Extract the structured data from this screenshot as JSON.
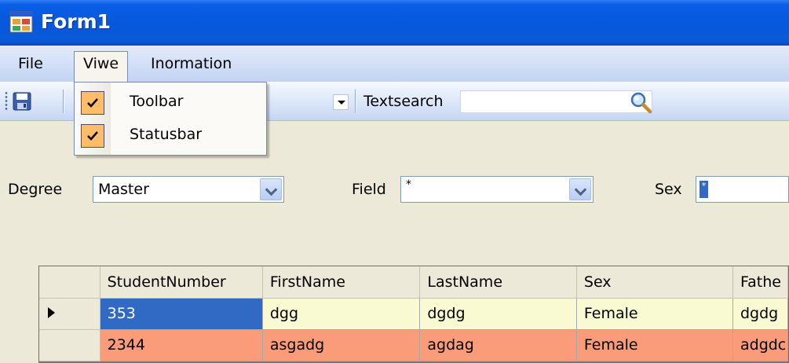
{
  "window": {
    "title": "Form1"
  },
  "menu": {
    "file": "File",
    "view": "Viwe",
    "information": "Inormation"
  },
  "view_menu": {
    "items": [
      {
        "label": "Toolbar",
        "checked": true
      },
      {
        "label": "Statusbar",
        "checked": true
      }
    ]
  },
  "toolbar": {
    "search_label": "Textsearch",
    "search_value": ""
  },
  "filters": {
    "degree_label": "Degree",
    "degree_value": "Master",
    "field_label": "Field",
    "field_value": "*",
    "sex_label": "Sex",
    "sex_value": "*"
  },
  "grid": {
    "columns": [
      "StudentNumber",
      "FirstName",
      "LastName",
      "Sex",
      "Fathe"
    ],
    "rows": [
      {
        "values": [
          "353",
          "dgg",
          "dgdg",
          "Female",
          "dgdg"
        ],
        "current": true
      },
      {
        "values": [
          "2344",
          "asgadg",
          "agdag",
          "Female",
          "adgdc"
        ],
        "current": false
      }
    ]
  },
  "colors": {
    "titlebar": "#0757dc",
    "selection": "#316ac5",
    "row_yellow": "#fafad2",
    "row_orange": "#fa9c7a",
    "check_bg": "#ffbd69"
  }
}
